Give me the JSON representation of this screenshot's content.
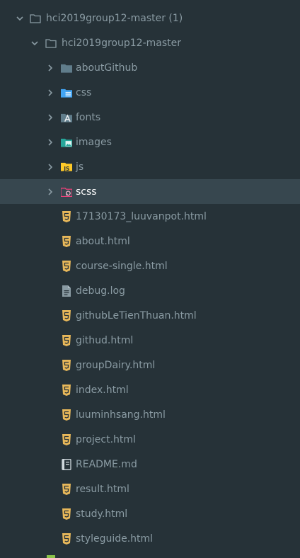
{
  "tree": {
    "root": {
      "label": "hci2019group12-master (1)",
      "expanded": true
    },
    "project": {
      "label": "hci2019group12-master",
      "expanded": true
    },
    "folders": [
      {
        "label": "aboutGithub",
        "icon": "folder-icon",
        "color": "#607d8b"
      },
      {
        "label": "css",
        "icon": "css-folder-icon",
        "color": "#42a5f5"
      },
      {
        "label": "fonts",
        "icon": "fonts-folder-icon",
        "color": "#607d8b"
      },
      {
        "label": "images",
        "icon": "images-folder-icon",
        "color": "#26a69a"
      },
      {
        "label": "js",
        "icon": "js-folder-icon",
        "color": "#ffca28"
      },
      {
        "label": "scss",
        "icon": "scss-folder-icon",
        "color": "#ec407a",
        "selected": true
      }
    ],
    "files": [
      {
        "label": "17130173_luuvanpot.html",
        "icon": "html5-icon"
      },
      {
        "label": "about.html",
        "icon": "html5-icon"
      },
      {
        "label": "course-single.html",
        "icon": "html5-icon"
      },
      {
        "label": "debug.log",
        "icon": "log-file-icon"
      },
      {
        "label": "githubLeTienThuan.html",
        "icon": "html5-icon"
      },
      {
        "label": "githud.html",
        "icon": "html5-icon"
      },
      {
        "label": "groupDairy.html",
        "icon": "html5-icon"
      },
      {
        "label": "index.html",
        "icon": "html5-icon"
      },
      {
        "label": "luuminhsang.html",
        "icon": "html5-icon"
      },
      {
        "label": "project.html",
        "icon": "html5-icon"
      },
      {
        "label": "README.md",
        "icon": "readme-icon"
      },
      {
        "label": "result.html",
        "icon": "html5-icon"
      },
      {
        "label": "study.html",
        "icon": "html5-icon"
      },
      {
        "label": "styleguide.html",
        "icon": "html5-icon"
      }
    ]
  },
  "colors": {
    "background": "#263238",
    "selected_row": "#37474f",
    "text": "#8a9ba3",
    "selected_text": "#ffffff",
    "html_icon": "#e8b85a"
  }
}
